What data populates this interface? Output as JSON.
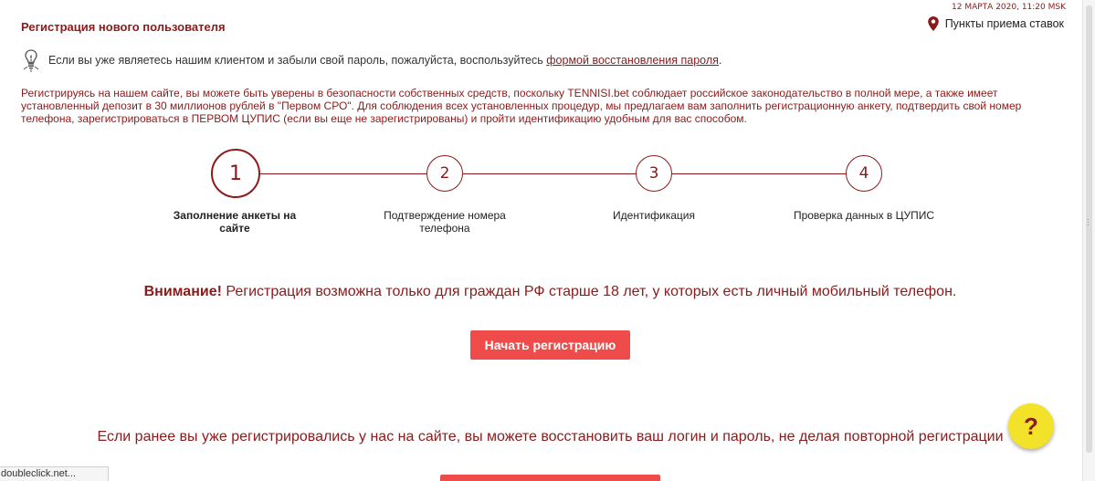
{
  "header": {
    "date": "12 МАРТА 2020, 11:20 MSK",
    "points_label": "Пункты приема ставок"
  },
  "registration": {
    "title": "Регистрация нового пользователя",
    "forgot_text": "Если вы уже являетесь нашим клиентом и забыли свой пароль, пожалуйста, воспользуйтесь",
    "forgot_link": "формой восстановления пароля",
    "forgot_end": ".",
    "intro": "Регистрируясь на нашем сайте, вы можете быть уверены в безопасности собственных средств, поскольку TENNISI.bet соблюдает российское законодательство в полной мере, а также имеет установленный депозит в 30 миллионов рублей в \"Первом СРО\". Для соблюдения всех установленных процедур, мы предлагаем вам заполнить регистрационную анкету, подтвердить свой номер телефона, зарегистрироваться в ПЕРВОМ ЦУПИС (если вы еще не зарегистрированы) и пройти идентификацию удобным для вас способом."
  },
  "steps": [
    {
      "number": "1",
      "label": "Заполнение анкеты на сайте",
      "active": true
    },
    {
      "number": "2",
      "label": "Подтверждение номера телефона",
      "active": false
    },
    {
      "number": "3",
      "label": "Идентификация",
      "active": false
    },
    {
      "number": "4",
      "label": "Проверка данных в ЦУПИС",
      "active": false
    }
  ],
  "warning": {
    "strong": "Внимание!",
    "text": " Регистрация возможна только для граждан РФ старше 18 лет, у которых есть личный мобильный телефон."
  },
  "start_button": "Начать регистрацию",
  "restore_text": "Если ранее вы уже регистрировались у нас на сайте, вы можете восстановить ваш логин и пароль, не делая повторной регистрации",
  "help_button": "?",
  "status_bar": "doubleclick.net...",
  "colors": {
    "brand": "#8b1a1a",
    "button": "#f04b4b",
    "help": "#f2e32a"
  }
}
